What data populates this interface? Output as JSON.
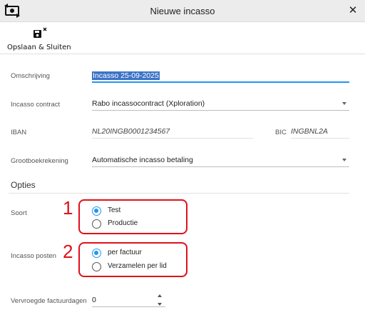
{
  "window": {
    "title": "Nieuwe incasso",
    "close_icon": "close-icon",
    "app_icon": "money-transfer-icon"
  },
  "toolbar": {
    "save_close_label": "Opslaan & Sluiten",
    "save_close_icon": "save-close-icon"
  },
  "form": {
    "omschrijving": {
      "label": "Omschrijving",
      "value": "Incasso 25-09-2025"
    },
    "contract": {
      "label": "Incasso contract",
      "value": "Rabo incassocontract (Xploration)"
    },
    "iban": {
      "label": "IBAN",
      "value": "NL20INGB0001234567"
    },
    "bic": {
      "label": "BIC",
      "value": "INGBNL2A"
    },
    "grootboek": {
      "label": "Grootboekrekening",
      "value": "Automatische incasso betaling"
    }
  },
  "opties": {
    "title": "Opties",
    "soort": {
      "label": "Soort",
      "options": [
        "Test",
        "Productie"
      ],
      "selected": "Test"
    },
    "posten": {
      "label": "Incasso posten",
      "options": [
        "per factuur",
        "Verzamelen per lid"
      ],
      "selected": "per factuur"
    },
    "vervroegde": {
      "label": "Vervroegde factuurdagen",
      "value": "0"
    }
  },
  "annotations": {
    "marker_1": "1",
    "marker_2": "2",
    "color": "#e0101a"
  },
  "colors": {
    "accent": "#2196f3",
    "selection": "#3d74c6"
  }
}
